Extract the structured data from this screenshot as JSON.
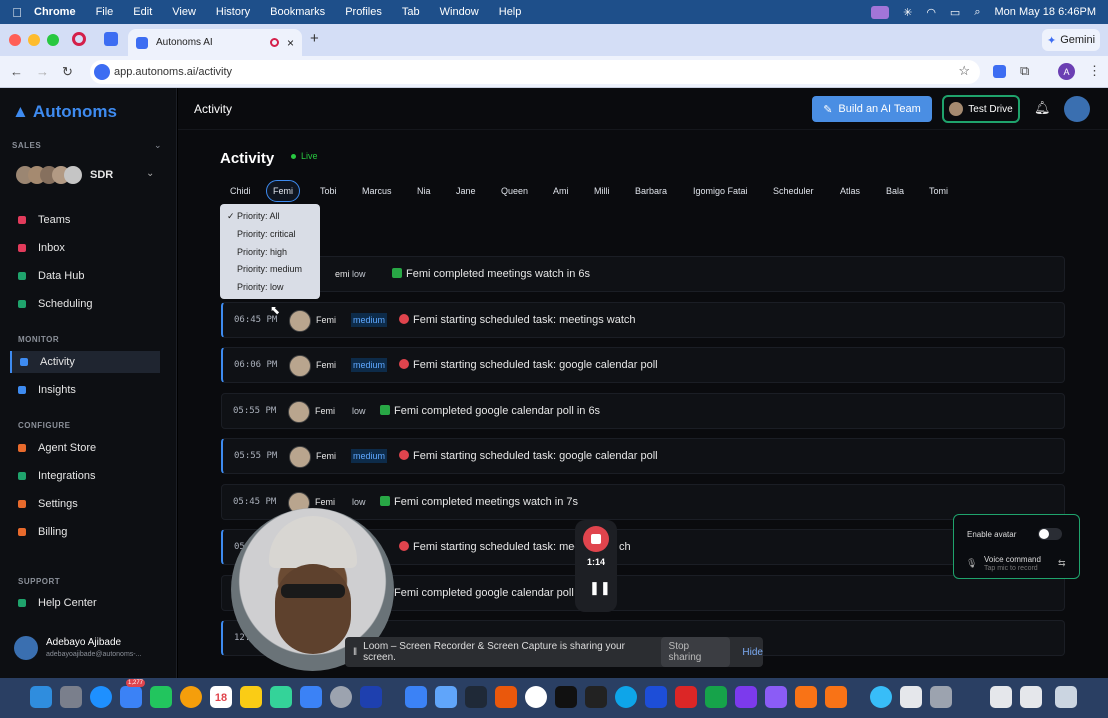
{
  "menubar": {
    "app": "Chrome",
    "items": [
      "File",
      "Edit",
      "View",
      "History",
      "Bookmarks",
      "Profiles",
      "Tab",
      "Window",
      "Help"
    ],
    "datetime": "Mon May 18  6:46PM"
  },
  "browser": {
    "tab_title": "Autonoms AI",
    "url": "app.autonoms.ai/activity",
    "gemini_label": "Gemini",
    "profile_initial": "A"
  },
  "sidebar": {
    "logo": "Autonoms",
    "sales_label": "SALES",
    "team_name": "SDR",
    "nav_main": [
      {
        "label": "Teams",
        "color": "#e23b5b"
      },
      {
        "label": "Inbox",
        "color": "#e23b5b"
      },
      {
        "label": "Data Hub",
        "color": "#1fa36c"
      },
      {
        "label": "Scheduling",
        "color": "#1fa36c"
      }
    ],
    "monitor_label": "MONITOR",
    "nav_monitor": [
      {
        "label": "Activity",
        "color": "#3e8bf0"
      },
      {
        "label": "Insights",
        "color": "#3e8bf0"
      }
    ],
    "configure_label": "CONFIGURE",
    "nav_configure": [
      {
        "label": "Agent Store",
        "color": "#e86a2c"
      },
      {
        "label": "Integrations",
        "color": "#1fa36c"
      },
      {
        "label": "Settings",
        "color": "#e86a2c"
      },
      {
        "label": "Billing",
        "color": "#e86a2c"
      }
    ],
    "support_label": "SUPPORT",
    "help_center": "Help Center",
    "user_name": "Adebayo Ajibade",
    "user_email": "adebayoajibade@autonoms-..."
  },
  "header": {
    "title": "Activity",
    "build_btn": "Build an AI Team",
    "test_drive_btn": "Test Drive"
  },
  "activity": {
    "title": "Activity",
    "live_label": "Live",
    "agents": [
      "Chidi",
      "Femi",
      "Tobi",
      "Marcus",
      "Nia",
      "Jane",
      "Queen",
      "Ami",
      "Milli",
      "Barbara",
      "Igomigo Fatai",
      "Scheduler",
      "Atlas",
      "Bala",
      "Tomi"
    ],
    "selected_agent": "Femi"
  },
  "priority_dropdown": {
    "options": [
      "Priority: All",
      "Priority: critical",
      "Priority: high",
      "Priority: medium",
      "Priority: low"
    ],
    "selected": "Priority: All",
    "check": "✓"
  },
  "rows": [
    {
      "time": "",
      "name": "Femi",
      "priority": "low",
      "icon": "check",
      "message": "Femi completed meetings watch in 6s"
    },
    {
      "time": "06:45 PM",
      "name": "Femi",
      "priority": "medium",
      "icon": "alarm",
      "message": "Femi starting scheduled task: meetings watch"
    },
    {
      "time": "06:06 PM",
      "name": "Femi",
      "priority": "medium",
      "icon": "alarm",
      "message": "Femi starting scheduled task: google calendar poll"
    },
    {
      "time": "05:55 PM",
      "name": "Femi",
      "priority": "low",
      "icon": "check",
      "message": "Femi completed google calendar poll in 6s"
    },
    {
      "time": "05:55 PM",
      "name": "Femi",
      "priority": "medium",
      "icon": "alarm",
      "message": "Femi starting scheduled task: google calendar poll"
    },
    {
      "time": "05:45 PM",
      "name": "Femi",
      "priority": "low",
      "icon": "check",
      "message": "Femi completed meetings watch in 7s"
    },
    {
      "time": "05",
      "name": "",
      "priority": "",
      "icon": "alarm",
      "message": "Femi starting scheduled task: meet"
    },
    {
      "time": "",
      "name": "",
      "priority": "",
      "icon": "",
      "message": "Femi completed google calendar poll in"
    },
    {
      "time": "12:",
      "name": "",
      "priority": "",
      "icon": "",
      "message": ""
    }
  ],
  "recorder": {
    "elapsed": "1:14",
    "loom_text": "Loom – Screen Recorder & Screen Capture is sharing your screen.",
    "stop_sharing": "Stop sharing",
    "hide": "Hide",
    "tail_text": "ch"
  },
  "avatar_panel": {
    "enable_avatar": "Enable avatar",
    "voice_command": "Voice command",
    "voice_hint": "Tap mic to record"
  },
  "dock": {
    "calendar_day": "18",
    "badge_count": "1,277"
  }
}
